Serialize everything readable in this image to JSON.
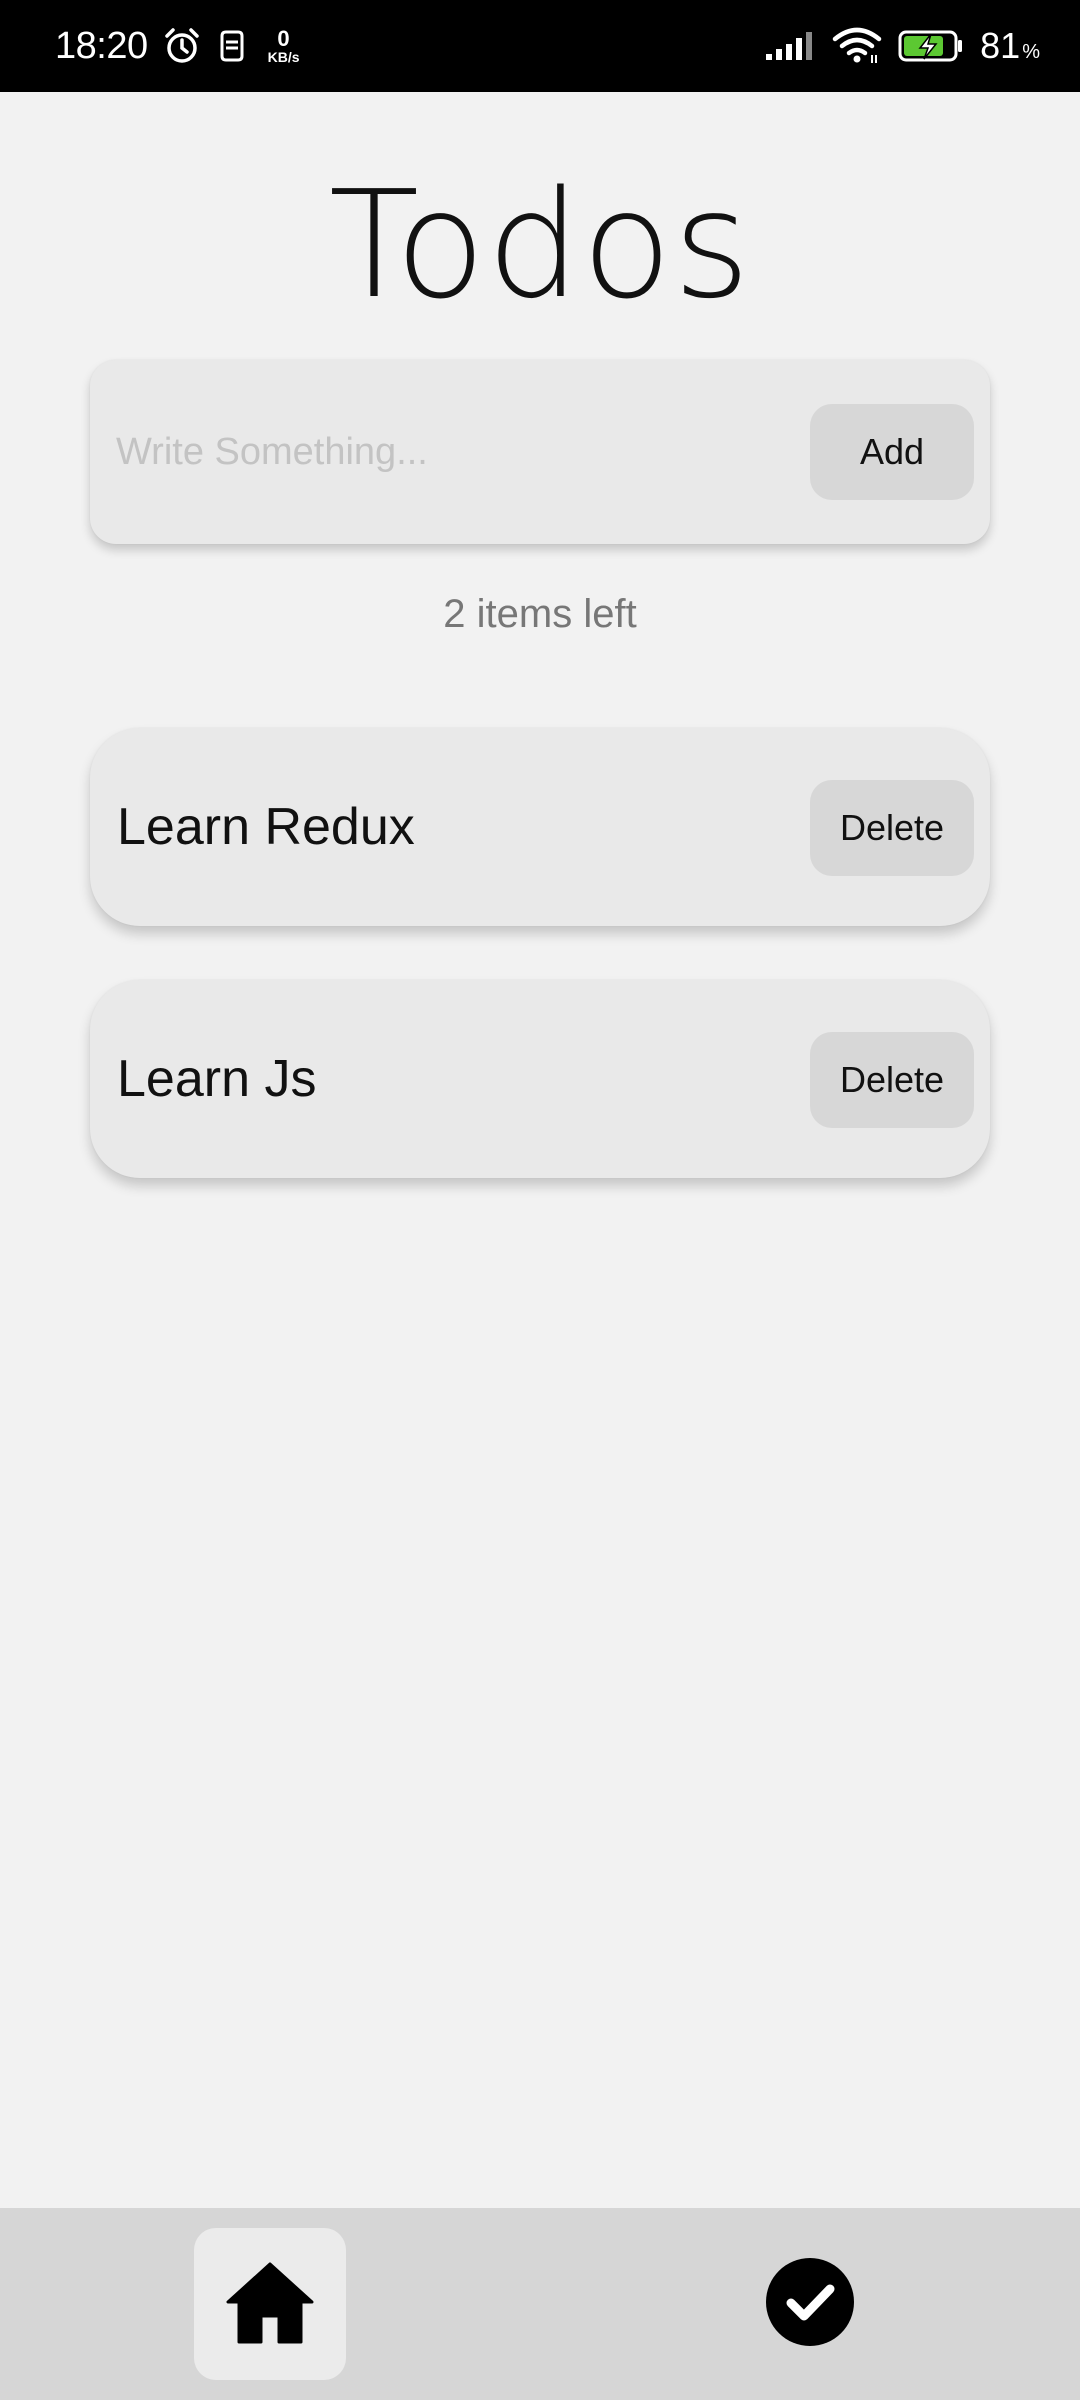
{
  "status_bar": {
    "time": "18:20",
    "net_speed_value": "0",
    "net_speed_unit": "KB/s",
    "battery_percent": "81",
    "battery_percent_sign": "%"
  },
  "header": {
    "title": "Todos"
  },
  "new_todo": {
    "value": "",
    "placeholder": "Write Something...",
    "add_label": "Add"
  },
  "summary": {
    "items_left": "2 items left"
  },
  "todos": [
    {
      "text": "Learn Redux",
      "delete_label": "Delete"
    },
    {
      "text": "Learn Js",
      "delete_label": "Delete"
    }
  ],
  "bottom_nav": {
    "items": [
      {
        "icon": "home-icon",
        "active": true
      },
      {
        "icon": "check-circle-icon",
        "active": false
      }
    ]
  },
  "colors": {
    "background": "#f2f2f2",
    "card": "#e9e9e9",
    "button": "#d7d7d7",
    "nav_bar": "#d6d6d6",
    "battery_charge": "#5cc832"
  }
}
